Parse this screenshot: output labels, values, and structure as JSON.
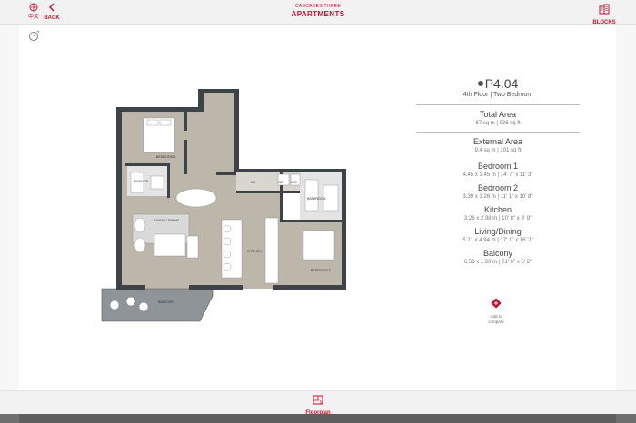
{
  "header": {
    "language_label": "中文",
    "back_label": "BACK",
    "subtitle": "CASCADES THREE",
    "title": "APARTMENTS",
    "blocks_label": "BLOCKS"
  },
  "floorplan": {
    "rooms": {
      "bedroom1": "BEDROOM 1",
      "ensuite": "ENSUITE",
      "living": "LIVING / DINING",
      "kitchen": "KITCHEN",
      "bathroom": "BATHROOM",
      "bedroom2": "BEDROOM 2",
      "balcony": "BALCONY",
      "cu": "CU",
      "wd": "WD",
      "wd2": "W/D"
    }
  },
  "unit": {
    "name": "P4.04",
    "floor_type": "4th Floor | Two Bedroom"
  },
  "areas": [
    {
      "label": "Total Area",
      "value": "87 sq m | 936 sq ft"
    },
    {
      "label": "External Area",
      "value": "9.4 sq m | 101 sq ft"
    }
  ],
  "rooms": [
    {
      "label": "Bedroom 1",
      "value": "4.45 x 3.45 m | 14' 7\" x 11' 3\""
    },
    {
      "label": "Bedroom 2",
      "value": "3.39 x 3.26 m | 11' 1\" x 10' 8\""
    },
    {
      "label": "Kitchen",
      "value": "3.26 x 2.98 m | 10' 8\" x 9' 9\""
    },
    {
      "label": "Living/Dining",
      "value": "5.21 x 4.94 m | 17' 1\" x 16' 2\""
    },
    {
      "label": "Balcony",
      "value": "6.56 x 1.60 m | 21' 6\" x 5' 2\""
    }
  ],
  "compare": {
    "label_line1": "Add to",
    "label_line2": "compare"
  },
  "bottom_nav": {
    "floorplan_label": "Floorplan"
  },
  "colors": {
    "accent": "#c8102e",
    "wall": "#3d4346",
    "floor": "#bdb6ab"
  }
}
